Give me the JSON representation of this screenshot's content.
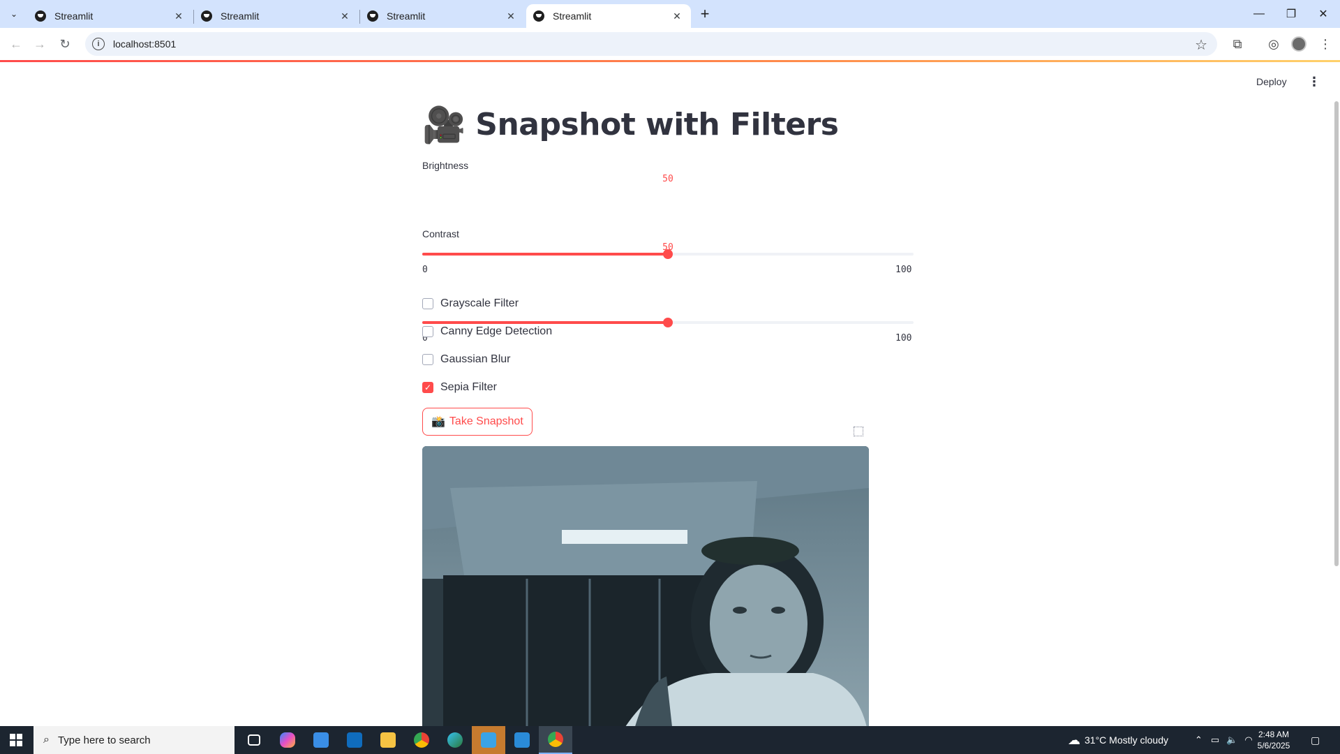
{
  "browser": {
    "tabs": [
      {
        "label": "Streamlit",
        "active": false
      },
      {
        "label": "Streamlit",
        "active": false
      },
      {
        "label": "Streamlit",
        "active": false
      },
      {
        "label": "Streamlit",
        "active": true
      }
    ],
    "url": "localhost:8501"
  },
  "app": {
    "deploy_label": "Deploy",
    "title_icon": "🎥",
    "title": "Snapshot with Filters",
    "brightness": {
      "label": "Brightness",
      "value": "50",
      "min": "0",
      "max": "100",
      "fraction": 0.5
    },
    "contrast": {
      "label": "Contrast",
      "value": "50",
      "min": "0",
      "max": "100",
      "fraction": 0.5
    },
    "filters": [
      {
        "label": "Grayscale Filter",
        "checked": false
      },
      {
        "label": "Canny Edge Detection",
        "checked": false
      },
      {
        "label": "Gaussian Blur",
        "checked": false
      },
      {
        "label": "Sepia Filter",
        "checked": true
      }
    ],
    "snapshot_button": {
      "icon": "📸",
      "label": "Take Snapshot"
    },
    "accent_color": "#ff4b4b"
  },
  "taskbar": {
    "search_placeholder": "Type here to search",
    "weather": "31°C  Mostly cloudy",
    "time": "2:48 AM",
    "date": "5/6/2025"
  }
}
